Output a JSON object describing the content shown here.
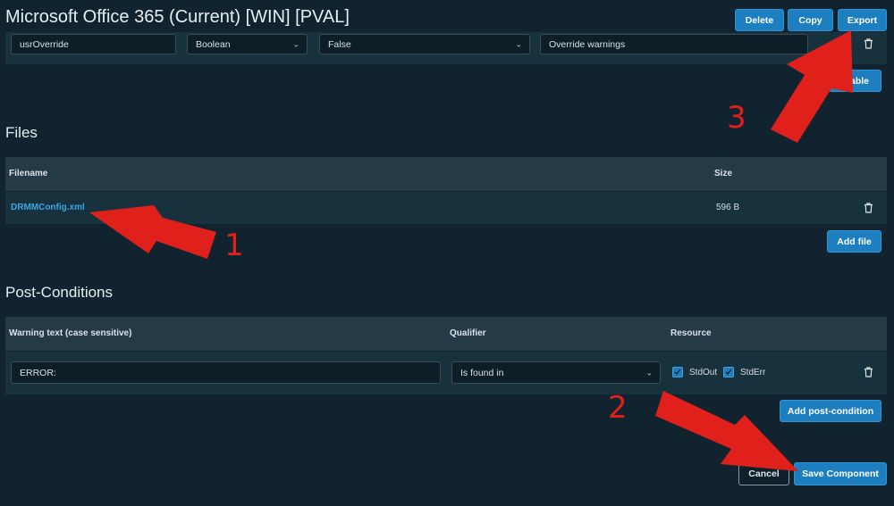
{
  "page": {
    "title": "Microsoft Office 365 (Current) [WIN] [PVAL]"
  },
  "header_actions": {
    "delete": "Delete",
    "copy": "Copy",
    "export": "Export"
  },
  "variable_row": {
    "name": "usrOverride",
    "type": "Boolean",
    "value": "False",
    "description": "Override warnings"
  },
  "variables": {
    "add_button_visible_text": "riable"
  },
  "files": {
    "title": "Files",
    "columns": {
      "filename": "Filename",
      "size": "Size"
    },
    "rows": [
      {
        "filename": "DRMMConfig.xml",
        "size": "596 B"
      }
    ],
    "add_button": "Add file"
  },
  "post_conditions": {
    "title": "Post-Conditions",
    "columns": {
      "warning": "Warning text (case sensitive)",
      "qualifier": "Qualifier",
      "resource": "Resource"
    },
    "rows": [
      {
        "warning": "ERROR:",
        "qualifier": "Is found in",
        "stdout": "StdOut",
        "stderr": "StdErr",
        "stdout_checked": true,
        "stderr_checked": true
      }
    ],
    "add_button": "Add post-condition"
  },
  "footer": {
    "cancel": "Cancel",
    "save": "Save Component"
  },
  "annotations": {
    "n1": "1",
    "n2": "2",
    "n3": "3",
    "color": "#e0201a"
  },
  "colors": {
    "accent": "#1d7fbf",
    "background": "#10232e",
    "link": "#3aa7e6"
  }
}
